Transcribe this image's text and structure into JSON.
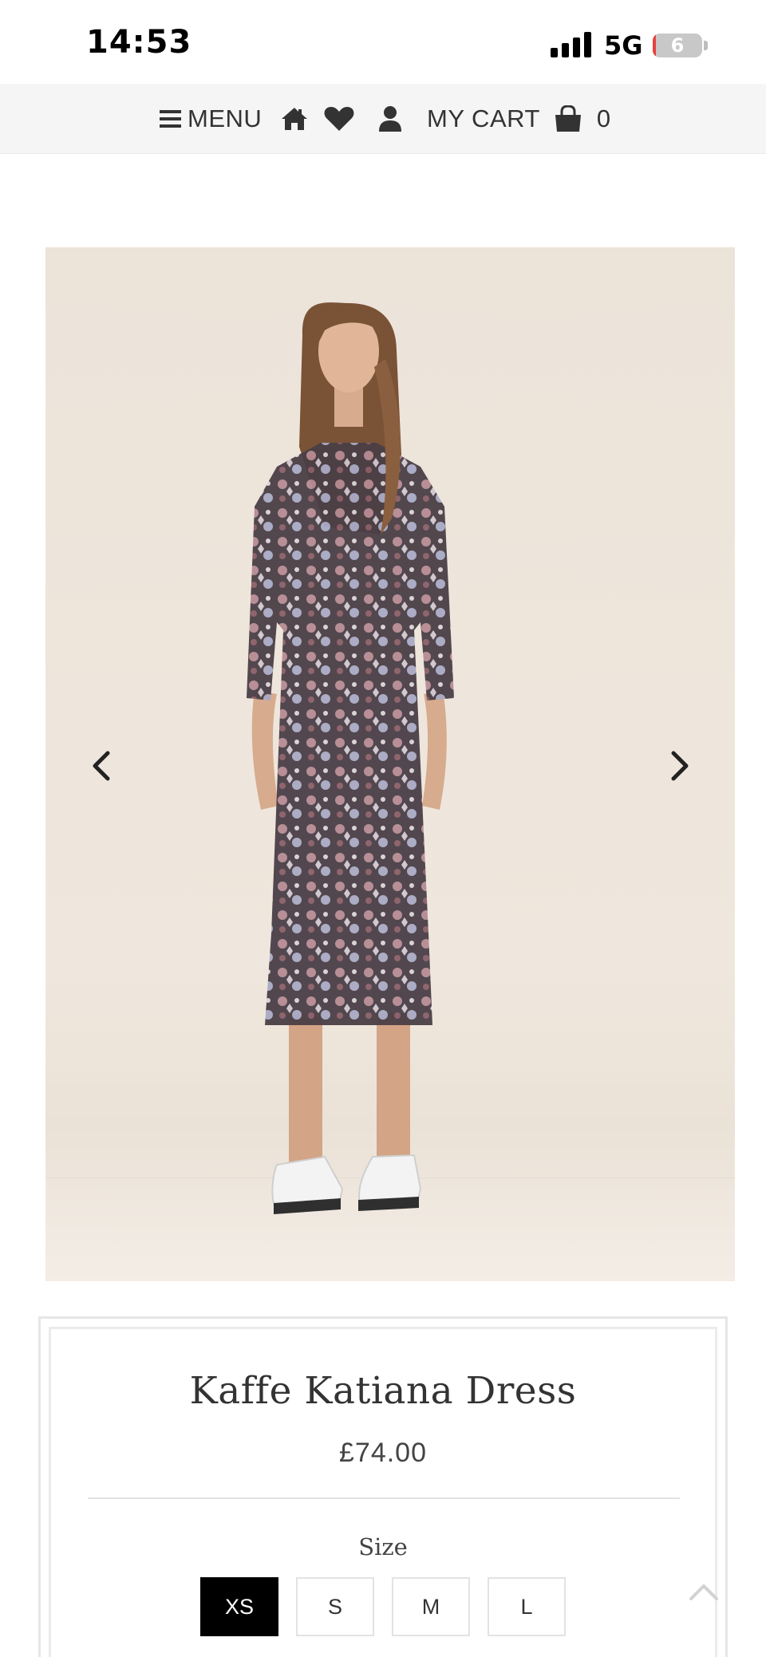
{
  "status_bar": {
    "time": "14:53",
    "network": "5G",
    "battery_level": "6"
  },
  "nav": {
    "menu_label": "MENU",
    "cart_label": "MY CART",
    "cart_count": "0",
    "icons": [
      "hamburger-icon",
      "home-icon",
      "heart-icon",
      "user-icon",
      "shopping-bag-icon"
    ]
  },
  "gallery": {
    "prev_icon": "chevron-left-icon",
    "next_icon": "chevron-right-icon"
  },
  "product": {
    "title": "Kaffe Katiana Dress",
    "price": "£74.00",
    "size_label": "Size",
    "sizes": [
      "XS",
      "S",
      "M",
      "L"
    ],
    "selected_size": "XS"
  },
  "colors": {
    "selected_size_bg": "#000000",
    "nav_bg": "#f5f5f5",
    "battery_low": "#e8413c"
  }
}
